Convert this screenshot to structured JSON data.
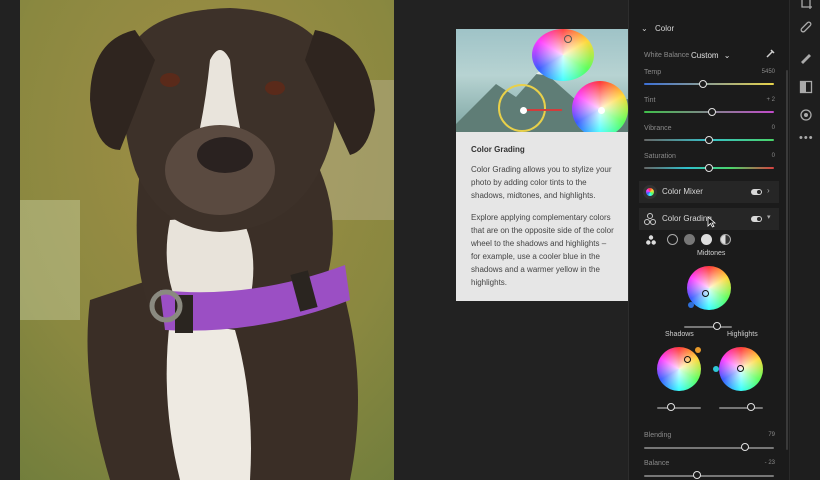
{
  "help_card": {
    "title": "Color Grading",
    "p1": "Color Grading allows you to stylize your photo by adding color tints to the shadows, midtones, and highlights.",
    "p2": "Explore applying complementary colors that are on the opposite side of the color wheel to the shadows and highlights – for example, use a cooler blue in the shadows and a warmer yellow in the highlights."
  },
  "color_section": {
    "title": "Color",
    "white_balance_label": "White Balance",
    "white_balance_value": "Custom",
    "sliders": [
      {
        "label": "Temp",
        "value": "5450",
        "level": 0.45
      },
      {
        "label": "Tint",
        "value": "+ 2",
        "level": 0.52
      },
      {
        "label": "Vibrance",
        "value": "0",
        "level": 0.5
      },
      {
        "label": "Saturation",
        "value": "0",
        "level": 0.5
      }
    ]
  },
  "mixer": {
    "label": "Color Mixer"
  },
  "grading": {
    "label": "Color Grading",
    "midtones_label": "Midtones",
    "shadows_label": "Shadows",
    "highlights_label": "Highlights",
    "blending_label": "Blending",
    "blending_value": "79",
    "balance_label": "Balance",
    "balance_value": "- 23"
  },
  "colors": {
    "panel_bg": "#1b1b1b",
    "card_bg": "#e6e6e6",
    "collar": "#9b4fc4"
  },
  "icons": [
    "chevron-down-icon",
    "eyedropper-icon",
    "color-mixer-icon",
    "color-grading-icon",
    "brush-icon",
    "healing-icon",
    "crop-icon",
    "mask-icon",
    "more-icon"
  ]
}
